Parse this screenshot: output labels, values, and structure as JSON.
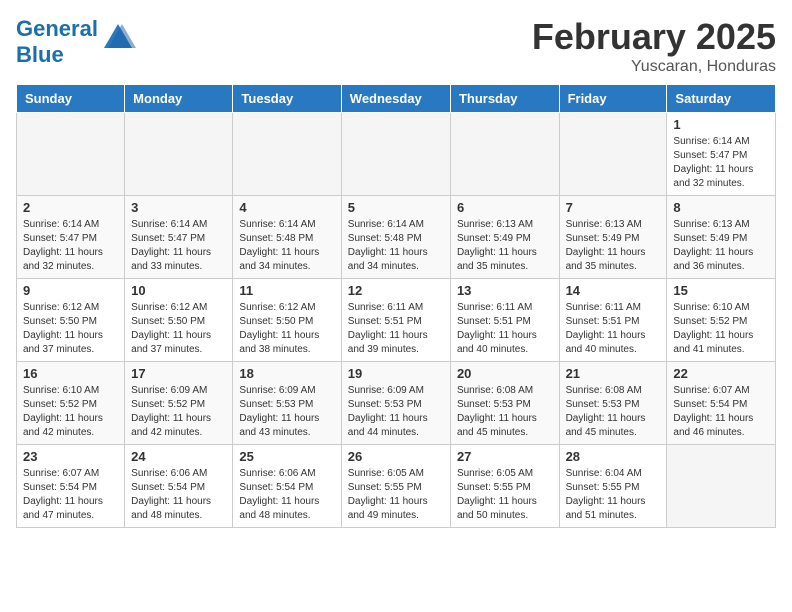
{
  "header": {
    "logo_general": "General",
    "logo_blue": "Blue",
    "title": "February 2025",
    "subtitle": "Yuscaran, Honduras"
  },
  "weekdays": [
    "Sunday",
    "Monday",
    "Tuesday",
    "Wednesday",
    "Thursday",
    "Friday",
    "Saturday"
  ],
  "weeks": [
    [
      {
        "day": "",
        "info": ""
      },
      {
        "day": "",
        "info": ""
      },
      {
        "day": "",
        "info": ""
      },
      {
        "day": "",
        "info": ""
      },
      {
        "day": "",
        "info": ""
      },
      {
        "day": "",
        "info": ""
      },
      {
        "day": "1",
        "info": "Sunrise: 6:14 AM\nSunset: 5:47 PM\nDaylight: 11 hours and 32 minutes."
      }
    ],
    [
      {
        "day": "2",
        "info": "Sunrise: 6:14 AM\nSunset: 5:47 PM\nDaylight: 11 hours and 32 minutes."
      },
      {
        "day": "3",
        "info": "Sunrise: 6:14 AM\nSunset: 5:47 PM\nDaylight: 11 hours and 33 minutes."
      },
      {
        "day": "4",
        "info": "Sunrise: 6:14 AM\nSunset: 5:48 PM\nDaylight: 11 hours and 34 minutes."
      },
      {
        "day": "5",
        "info": "Sunrise: 6:14 AM\nSunset: 5:48 PM\nDaylight: 11 hours and 34 minutes."
      },
      {
        "day": "6",
        "info": "Sunrise: 6:13 AM\nSunset: 5:49 PM\nDaylight: 11 hours and 35 minutes."
      },
      {
        "day": "7",
        "info": "Sunrise: 6:13 AM\nSunset: 5:49 PM\nDaylight: 11 hours and 35 minutes."
      },
      {
        "day": "8",
        "info": "Sunrise: 6:13 AM\nSunset: 5:49 PM\nDaylight: 11 hours and 36 minutes."
      }
    ],
    [
      {
        "day": "9",
        "info": "Sunrise: 6:12 AM\nSunset: 5:50 PM\nDaylight: 11 hours and 37 minutes."
      },
      {
        "day": "10",
        "info": "Sunrise: 6:12 AM\nSunset: 5:50 PM\nDaylight: 11 hours and 37 minutes."
      },
      {
        "day": "11",
        "info": "Sunrise: 6:12 AM\nSunset: 5:50 PM\nDaylight: 11 hours and 38 minutes."
      },
      {
        "day": "12",
        "info": "Sunrise: 6:11 AM\nSunset: 5:51 PM\nDaylight: 11 hours and 39 minutes."
      },
      {
        "day": "13",
        "info": "Sunrise: 6:11 AM\nSunset: 5:51 PM\nDaylight: 11 hours and 40 minutes."
      },
      {
        "day": "14",
        "info": "Sunrise: 6:11 AM\nSunset: 5:51 PM\nDaylight: 11 hours and 40 minutes."
      },
      {
        "day": "15",
        "info": "Sunrise: 6:10 AM\nSunset: 5:52 PM\nDaylight: 11 hours and 41 minutes."
      }
    ],
    [
      {
        "day": "16",
        "info": "Sunrise: 6:10 AM\nSunset: 5:52 PM\nDaylight: 11 hours and 42 minutes."
      },
      {
        "day": "17",
        "info": "Sunrise: 6:09 AM\nSunset: 5:52 PM\nDaylight: 11 hours and 42 minutes."
      },
      {
        "day": "18",
        "info": "Sunrise: 6:09 AM\nSunset: 5:53 PM\nDaylight: 11 hours and 43 minutes."
      },
      {
        "day": "19",
        "info": "Sunrise: 6:09 AM\nSunset: 5:53 PM\nDaylight: 11 hours and 44 minutes."
      },
      {
        "day": "20",
        "info": "Sunrise: 6:08 AM\nSunset: 5:53 PM\nDaylight: 11 hours and 45 minutes."
      },
      {
        "day": "21",
        "info": "Sunrise: 6:08 AM\nSunset: 5:53 PM\nDaylight: 11 hours and 45 minutes."
      },
      {
        "day": "22",
        "info": "Sunrise: 6:07 AM\nSunset: 5:54 PM\nDaylight: 11 hours and 46 minutes."
      }
    ],
    [
      {
        "day": "23",
        "info": "Sunrise: 6:07 AM\nSunset: 5:54 PM\nDaylight: 11 hours and 47 minutes."
      },
      {
        "day": "24",
        "info": "Sunrise: 6:06 AM\nSunset: 5:54 PM\nDaylight: 11 hours and 48 minutes."
      },
      {
        "day": "25",
        "info": "Sunrise: 6:06 AM\nSunset: 5:54 PM\nDaylight: 11 hours and 48 minutes."
      },
      {
        "day": "26",
        "info": "Sunrise: 6:05 AM\nSunset: 5:55 PM\nDaylight: 11 hours and 49 minutes."
      },
      {
        "day": "27",
        "info": "Sunrise: 6:05 AM\nSunset: 5:55 PM\nDaylight: 11 hours and 50 minutes."
      },
      {
        "day": "28",
        "info": "Sunrise: 6:04 AM\nSunset: 5:55 PM\nDaylight: 11 hours and 51 minutes."
      },
      {
        "day": "",
        "info": ""
      }
    ]
  ]
}
